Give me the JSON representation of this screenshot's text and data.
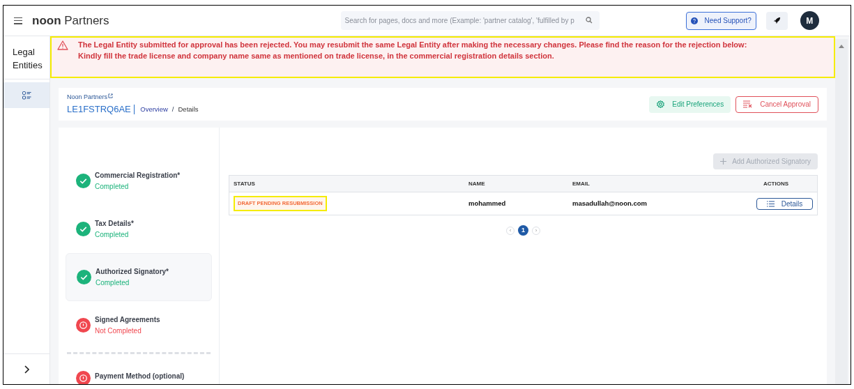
{
  "header": {
    "logo_bold": "noon",
    "logo_text": "Partners",
    "search": {
      "placeholder": "Search for pages, docs and more (Example: 'partner catalog', 'fulfilled by p"
    },
    "support_button": "Need Support?",
    "avatar": "M"
  },
  "sidebar": {
    "title": "Legal Entities",
    "items": [
      {
        "selected": true
      }
    ]
  },
  "alert": {
    "message": "The Legal Entity submitted for approval has been rejected. You may resubmit the same Legal Entity after making the necessary changes. Please find the reason for the rejection below:",
    "reason": "Kindly fill the trade license and company name same as mentioned on trade license, in the commercial registration details section."
  },
  "page_header": {
    "parent_link": "Noon Partners",
    "entity_id": "LE1FSTRQ6AE",
    "separator": "/",
    "breadcrumbs": [
      {
        "label": "Overview",
        "selected": false
      },
      {
        "label": "Details",
        "selected": true
      }
    ],
    "buttons": [
      {
        "kind": "preferences",
        "label": "Edit Preferences"
      },
      {
        "kind": "cancel",
        "label": "Cancel Approval"
      }
    ]
  },
  "steps": [
    {
      "title": "Commercial Registration*",
      "status_text": "Completed",
      "kind": "done",
      "selected": false
    },
    {
      "title": "Tax Details*",
      "status_text": "Completed",
      "kind": "done",
      "selected": false
    },
    {
      "title": "Authorized Signatory*",
      "status_text": "Completed",
      "kind": "done",
      "selected": true
    },
    {
      "title": "Signed Agreements",
      "status_text": "Not Completed",
      "kind": "pending",
      "selected": false
    },
    {
      "title": "Payment Method (optional)",
      "kind": "pending",
      "selected": false
    }
  ],
  "add_button": {
    "label": "Add Authorized Signatory",
    "disabled": true
  },
  "table": {
    "columns": [
      "STATUS",
      "NAME",
      "EMAIL",
      "ACTIONS"
    ],
    "rows": [
      {
        "status": "DRAFT PENDING RESUBMISSION",
        "name": "mohammed",
        "email": "masadullah@noon.com",
        "action": "Details"
      }
    ]
  },
  "pagination": {
    "prev": "‹",
    "pages": [
      {
        "label": "1",
        "selected": true
      }
    ],
    "next": "›"
  }
}
